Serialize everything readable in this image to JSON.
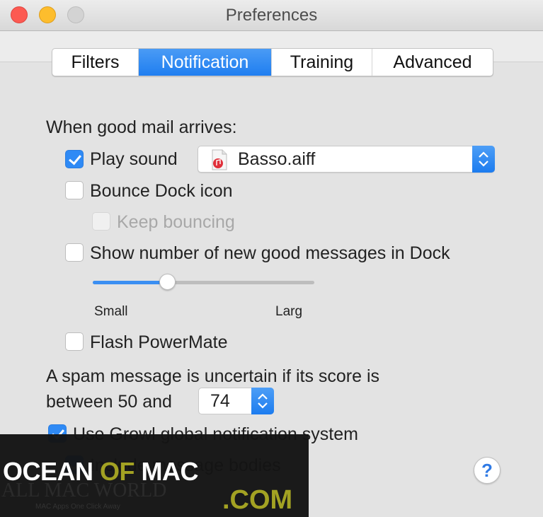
{
  "window": {
    "title": "Preferences",
    "buttons": [
      "close",
      "minimize",
      "zoom"
    ]
  },
  "tabs": [
    {
      "label": "Filters",
      "active": false
    },
    {
      "label": "Notification",
      "active": true
    },
    {
      "label": "Training",
      "active": false
    },
    {
      "label": "Advanced",
      "active": false
    }
  ],
  "good_mail": {
    "heading": "When good mail arrives:",
    "play_sound": {
      "label": "Play sound",
      "checked": true
    },
    "sound_popup": {
      "value": "Basso.aiff",
      "icon": "audio-file-icon"
    },
    "bounce_dock": {
      "label": "Bounce Dock icon",
      "checked": false
    },
    "keep_bouncing": {
      "label": "Keep bouncing",
      "checked": false,
      "enabled": false
    },
    "show_number": {
      "label": "Show number of new good messages in Dock",
      "checked": false
    },
    "size_slider": {
      "value_fraction": 0.34,
      "min_label": "Small",
      "max_label": "Larg"
    },
    "flash_powermate": {
      "label": "Flash PowerMate",
      "checked": false
    }
  },
  "spam": {
    "line1": "A spam message is uncertain if its score is",
    "line2": "between 50 and",
    "score_value": "74"
  },
  "growl": {
    "use_growl": {
      "label": "Use Growl global notification system",
      "checked": true
    },
    "include_bodies": {
      "label": "Include message bodies",
      "checked": true
    }
  },
  "help_button": {
    "label": "?"
  },
  "watermark": {
    "brand_part1": "OCEAN",
    "brand_part2": "OF",
    "brand_part3": "MAC",
    "domain": ".COM",
    "sub_brand": "ALL MAC WORLD",
    "tagline": "MAC Apps One Click Away"
  }
}
